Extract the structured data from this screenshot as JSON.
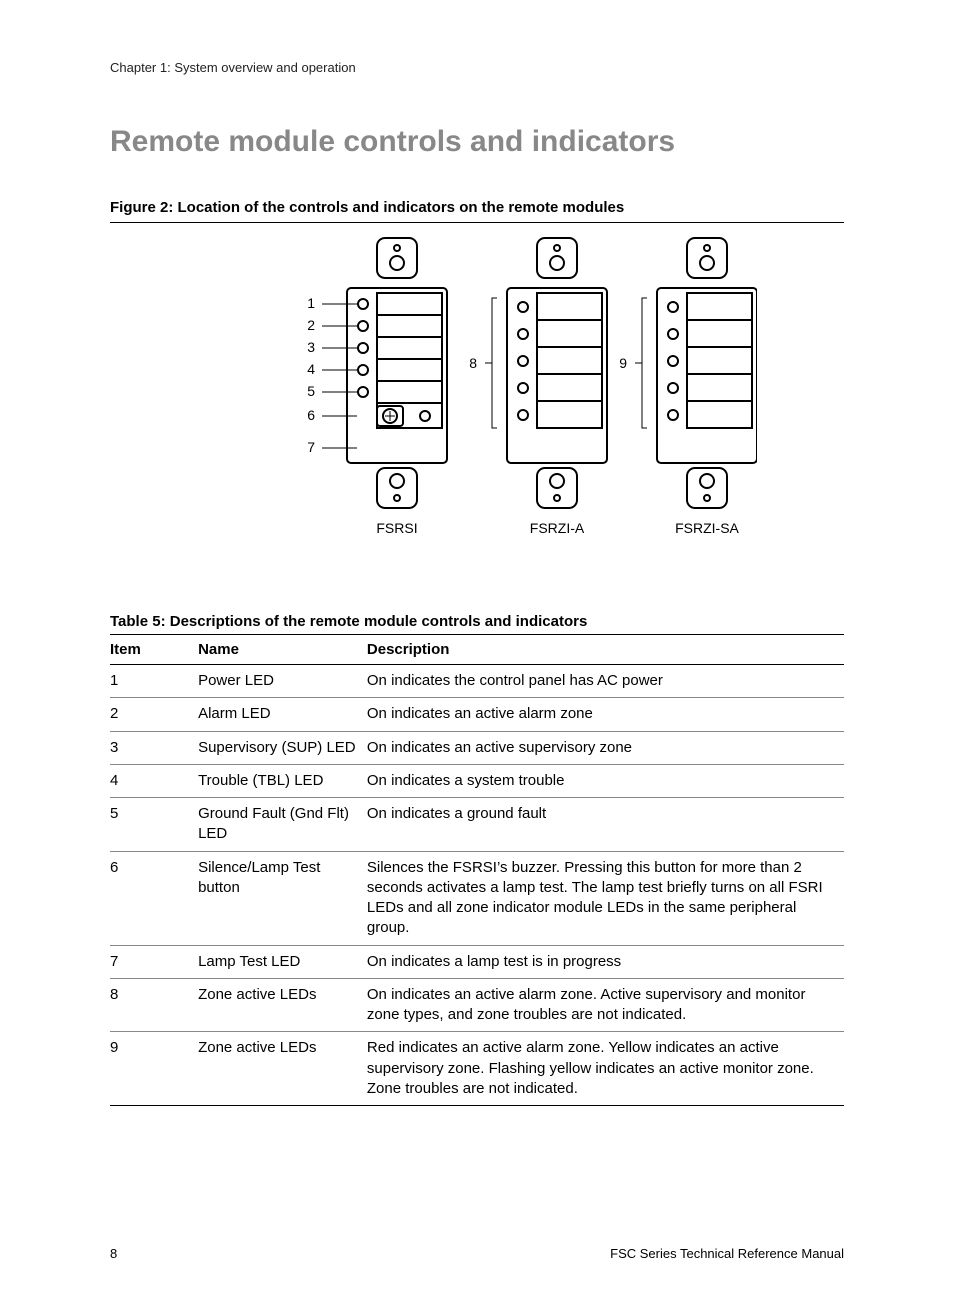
{
  "chapter": "Chapter 1: System overview and operation",
  "heading": "Remote module controls and indicators",
  "figure_caption": "Figure 2: Location of the controls and indicators on the remote modules",
  "callouts": {
    "c1": "1",
    "c2": "2",
    "c3": "3",
    "c4": "4",
    "c5": "5",
    "c6": "6",
    "c7": "7",
    "c8": "8",
    "c9": "9"
  },
  "module_labels": {
    "m1": "FSRSI",
    "m2": "FSRZI-A",
    "m3": "FSRZI-SA"
  },
  "table_caption": "Table 5: Descriptions of the remote module controls and indicators",
  "table_headers": {
    "item": "Item",
    "name": "Name",
    "desc": "Description"
  },
  "rows": [
    {
      "item": "1",
      "name": "Power LED",
      "desc": "On indicates the control panel has AC power"
    },
    {
      "item": "2",
      "name": "Alarm LED",
      "desc": "On indicates an active alarm zone"
    },
    {
      "item": "3",
      "name": "Supervisory (SUP) LED",
      "desc": "On indicates an active supervisory zone"
    },
    {
      "item": "4",
      "name": "Trouble (TBL) LED",
      "desc": "On indicates a system trouble"
    },
    {
      "item": "5",
      "name": "Ground Fault (Gnd Flt) LED",
      "desc": "On indicates a ground fault"
    },
    {
      "item": "6",
      "name": "Silence/Lamp Test button",
      "desc": "Silences the FSRSI’s buzzer. Pressing this button for more than 2 seconds activates a lamp test. The lamp test briefly turns on all FSRI LEDs and all zone indicator module LEDs in the same peripheral group."
    },
    {
      "item": "7",
      "name": "Lamp Test LED",
      "desc": "On indicates a lamp test is in progress"
    },
    {
      "item": "8",
      "name": "Zone active LEDs",
      "desc": "On indicates an active alarm zone. Active supervisory and monitor zone types, and zone troubles are not indicated."
    },
    {
      "item": "9",
      "name": "Zone active LEDs",
      "desc": "Red indicates an active alarm zone. Yellow indicates an active supervisory zone. Flashing yellow indicates an active monitor zone. Zone troubles are not indicated."
    }
  ],
  "footer": {
    "page": "8",
    "doc": "FSC Series Technical Reference Manual"
  }
}
